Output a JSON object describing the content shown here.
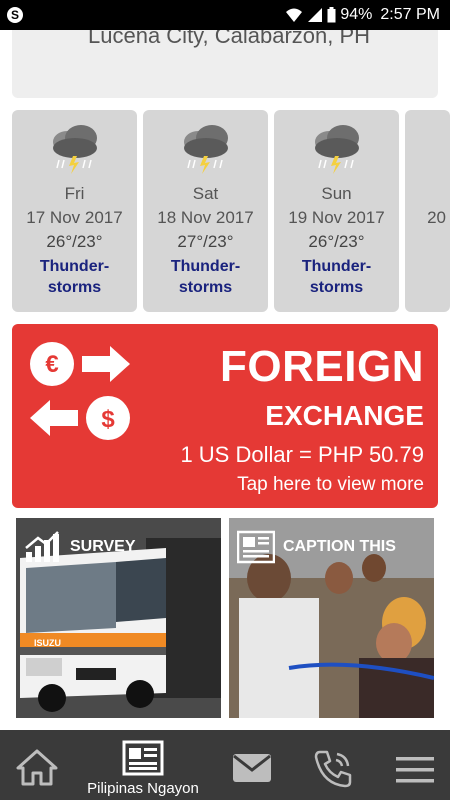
{
  "status_bar": {
    "battery": "94%",
    "time": "2:57 PM"
  },
  "location": {
    "text": "Lucena City, Calabarzon, PH"
  },
  "forecast": [
    {
      "day": "Fri",
      "date": "17 Nov 2017",
      "temp": "26°/23°",
      "condition": "Thunder-storms"
    },
    {
      "day": "Sat",
      "date": "18 Nov 2017",
      "temp": "27°/23°",
      "condition": "Thunder-storms"
    },
    {
      "day": "Sun",
      "date": "19 Nov 2017",
      "temp": "26°/23°",
      "condition": "Thunder-storms"
    },
    {
      "day": "",
      "date": "20",
      "temp": "",
      "condition": ""
    }
  ],
  "fx": {
    "title1": "FOREIGN",
    "title2": "EXCHANGE",
    "rate": "1 US Dollar = PHP 50.79",
    "link": "Tap here to view more",
    "color": "#e53935"
  },
  "tiles": {
    "survey_label": "SURVEY",
    "caption_label": "CAPTION THIS"
  },
  "bottom_nav": {
    "home_icon": "home-icon",
    "news_label": "Pilipinas Ngayon",
    "mail_icon": "mail-icon",
    "phone_icon": "phone-icon",
    "menu_icon": "menu-icon"
  }
}
